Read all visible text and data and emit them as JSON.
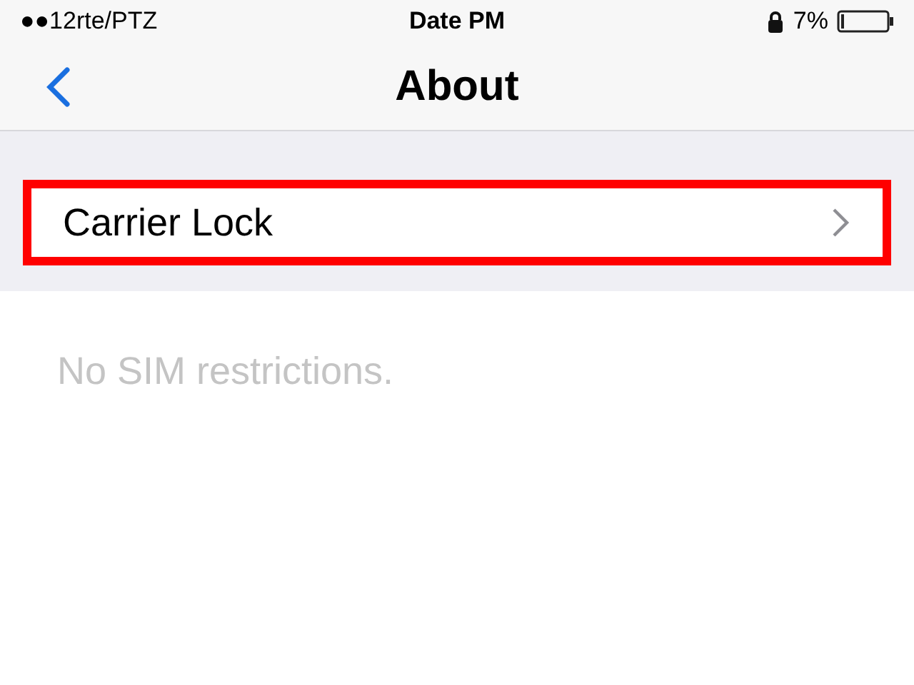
{
  "status_bar": {
    "carrier": "●●12rte/PTZ",
    "time": "Date PM",
    "battery": "7%"
  },
  "nav": {
    "title": "About"
  },
  "rows": [
    {
      "label": "Carrier Lock",
      "highlighted": true
    }
  ],
  "footer": "No SIM restrictions."
}
